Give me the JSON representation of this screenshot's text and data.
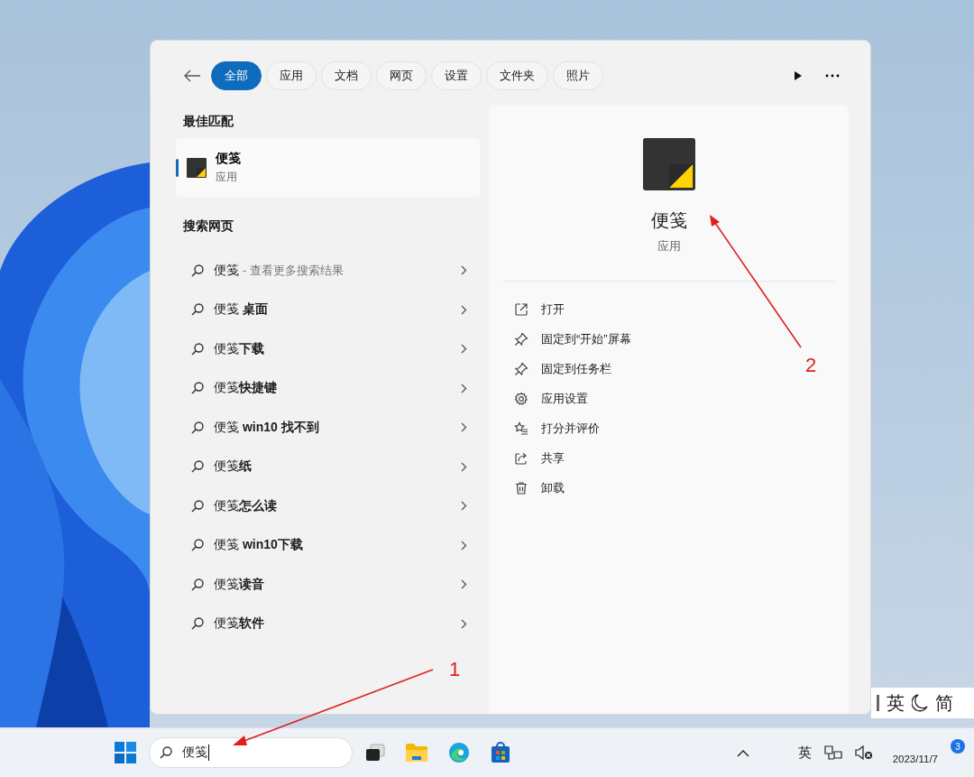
{
  "search_panel": {
    "tabs": [
      {
        "label": "全部",
        "selected": true
      },
      {
        "label": "应用",
        "selected": false
      },
      {
        "label": "文档",
        "selected": false
      },
      {
        "label": "网页",
        "selected": false
      },
      {
        "label": "设置",
        "selected": false
      },
      {
        "label": "文件夹",
        "selected": false
      },
      {
        "label": "照片",
        "selected": false
      }
    ],
    "best_match": {
      "heading": "最佳匹配",
      "title": "便笺",
      "subtitle": "应用",
      "selected": true
    },
    "web": {
      "heading": "搜索网页",
      "items": [
        {
          "query": "便笺",
          "hint": "- 查看更多搜索结果"
        },
        {
          "query": "便笺 **桌面**"
        },
        {
          "query": "便笺**下载**"
        },
        {
          "query": "便笺**快捷键**"
        },
        {
          "query": "便笺 **win10 找不到**"
        },
        {
          "query": "便笺**纸**"
        },
        {
          "query": "便笺**怎么读**"
        },
        {
          "query": "便笺 **win10下载**"
        },
        {
          "query": "便笺**读音**"
        },
        {
          "query": "便笺**软件**"
        }
      ]
    },
    "details": {
      "title": "便笺",
      "subtitle": "应用",
      "actions": [
        {
          "label": "打开",
          "kind": "open"
        },
        {
          "label": "固定到“开始”屏幕",
          "kind": "pin"
        },
        {
          "label": "固定到任务栏",
          "kind": "pin"
        },
        {
          "label": "应用设置",
          "kind": "settings"
        },
        {
          "label": "打分并评价",
          "kind": "rate"
        },
        {
          "label": "共享",
          "kind": "share"
        },
        {
          "label": "卸载",
          "kind": "uninstall"
        }
      ]
    }
  },
  "taskbar": {
    "search_value": "便笺",
    "ime": "英",
    "date": "2023/11/7",
    "badge": "3"
  },
  "ime_bar": {
    "mode": "英",
    "script": "简"
  },
  "annotations": [
    {
      "label": "1"
    },
    {
      "label": "2"
    }
  ]
}
